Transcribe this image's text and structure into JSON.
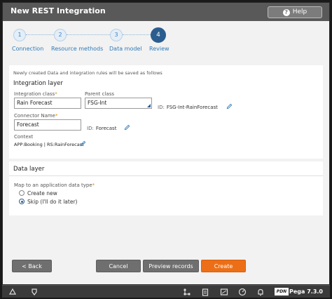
{
  "window": {
    "title": "New REST Integration",
    "help_label": "Help"
  },
  "steps": [
    {
      "number": "1",
      "label": "Connection"
    },
    {
      "number": "2",
      "label": "Resource methods"
    },
    {
      "number": "3",
      "label": "Data model"
    },
    {
      "number": "4",
      "label": "Review"
    }
  ],
  "info_text": "Newly created Data and integration rules will be saved as follows",
  "integration_layer": {
    "title": "Integration layer",
    "integration_class_label": "Integration class",
    "integration_class_value": "Rain Forecast",
    "parent_class_label": "Parent class",
    "parent_class_value": "FSG-Int",
    "class_id_label": "ID:",
    "class_id_value": "FSG-Int-RainForecast",
    "connector_name_label": "Connector Name",
    "connector_name_value": "Forecast",
    "connector_id_label": "ID:",
    "connector_id_value": "Forecast",
    "context_label": "Context",
    "context_value": "APP:Booking | RS:RainForecast"
  },
  "data_layer": {
    "title": "Data layer",
    "map_label": "Map to an application data type",
    "options": [
      "Create new",
      "Skip (I'll do it later)"
    ],
    "selected_index": 1
  },
  "buttons": {
    "back": "< Back",
    "cancel": "Cancel",
    "preview": "Preview records",
    "create": "Create"
  },
  "taskbar": {
    "pdn_label": "PDN",
    "version": "Pega 7.3.0"
  },
  "colors": {
    "accent_blue": "#2c5d8f",
    "link_blue": "#2f7ab8",
    "create_orange": "#ec6f17"
  }
}
